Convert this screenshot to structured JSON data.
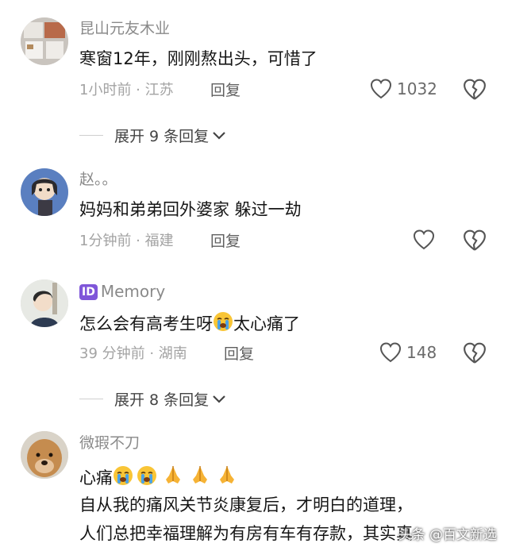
{
  "comments": [
    {
      "username": "昆山元友木业",
      "text": "寒窗12年，刚刚熬出头，可惜了",
      "time_location": "1小时前 · 江苏",
      "reply_label": "回复",
      "likes": "1032",
      "expand_label": "展开 9 条回复"
    },
    {
      "username": "赵。。",
      "text": "妈妈和弟弟回外婆家  躲过一劫",
      "time_location": "1分钟前 · 福建",
      "reply_label": "回复"
    },
    {
      "badge": "ID",
      "username": "Memory",
      "text_before": "怎么会有高考生呀",
      "text_after": "太心痛了",
      "time_location": "39 分钟前 · 湖南",
      "reply_label": "回复",
      "likes": "148",
      "expand_label": "展开 8 条回复"
    },
    {
      "username": "微瑕不刀",
      "line1": "心痛",
      "line2": "自从我的痛风关节炎康复后，才明白的道理，",
      "line3": "人们总把幸福理解为有房有车有存款，其实真"
    }
  ],
  "watermark": "头条 @百文新选",
  "icons": {
    "like": "heart-outline-icon",
    "dislike": "broken-heart-icon",
    "expand": "chevron-down-icon",
    "crying": "loudly-crying-face-emoji",
    "pray": "folded-hands-emoji"
  }
}
